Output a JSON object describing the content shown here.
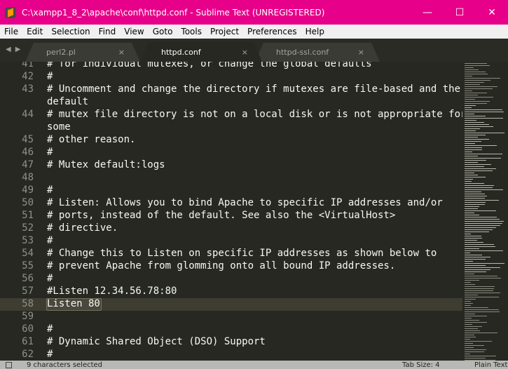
{
  "window": {
    "title": "C:\\xampp1_8_2\\apache\\conf\\httpd.conf - Sublime Text (UNREGISTERED)",
    "minimize": "—",
    "maximize": "☐",
    "close": "✕"
  },
  "menu": [
    "File",
    "Edit",
    "Selection",
    "Find",
    "View",
    "Goto",
    "Tools",
    "Project",
    "Preferences",
    "Help"
  ],
  "tabs": [
    {
      "label": "perl2.pl",
      "active": false
    },
    {
      "label": "httpd.conf",
      "active": true
    },
    {
      "label": "httpd-ssl.conf",
      "active": false
    }
  ],
  "tab_close": "×",
  "nav": {
    "back": "◀",
    "forward": "▶"
  },
  "editor": {
    "rows": [
      {
        "num": "41",
        "text": "# for individual mutexes, or change the global defaults"
      },
      {
        "num": "42",
        "text": "#"
      },
      {
        "num": "43",
        "text": "# Uncomment and change the directory if mutexes are file-based and the"
      },
      {
        "num": "",
        "text": "default"
      },
      {
        "num": "44",
        "text": "# mutex file directory is not on a local disk or is not appropriate for"
      },
      {
        "num": "",
        "text": "some"
      },
      {
        "num": "45",
        "text": "# other reason."
      },
      {
        "num": "46",
        "text": "#"
      },
      {
        "num": "47",
        "text": "# Mutex default:logs"
      },
      {
        "num": "48",
        "text": ""
      },
      {
        "num": "49",
        "text": "#"
      },
      {
        "num": "50",
        "text": "# Listen: Allows you to bind Apache to specific IP addresses and/or"
      },
      {
        "num": "51",
        "text": "# ports, instead of the default. See also the <VirtualHost>"
      },
      {
        "num": "52",
        "text": "# directive."
      },
      {
        "num": "53",
        "text": "#"
      },
      {
        "num": "54",
        "text": "# Change this to Listen on specific IP addresses as shown below to"
      },
      {
        "num": "55",
        "text": "# prevent Apache from glomming onto all bound IP addresses."
      },
      {
        "num": "56",
        "text": "#"
      },
      {
        "num": "57",
        "text": "#Listen 12.34.56.78:80"
      },
      {
        "num": "58",
        "text": "Listen 80"
      },
      {
        "num": "59",
        "text": ""
      },
      {
        "num": "60",
        "text": "#"
      },
      {
        "num": "61",
        "text": "# Dynamic Shared Object (DSO) Support"
      },
      {
        "num": "62",
        "text": "#"
      }
    ],
    "current_line": "58",
    "selected_text": "Listen 80"
  },
  "status": {
    "selection": "9 characters selected",
    "tab_size": "Tab Size: 4",
    "syntax": "Plain Text"
  },
  "colors": {
    "titlebar": "#e7008a",
    "editor_bg": "#272822",
    "text": "#f8f8f2",
    "gutter": "#8f908a"
  }
}
